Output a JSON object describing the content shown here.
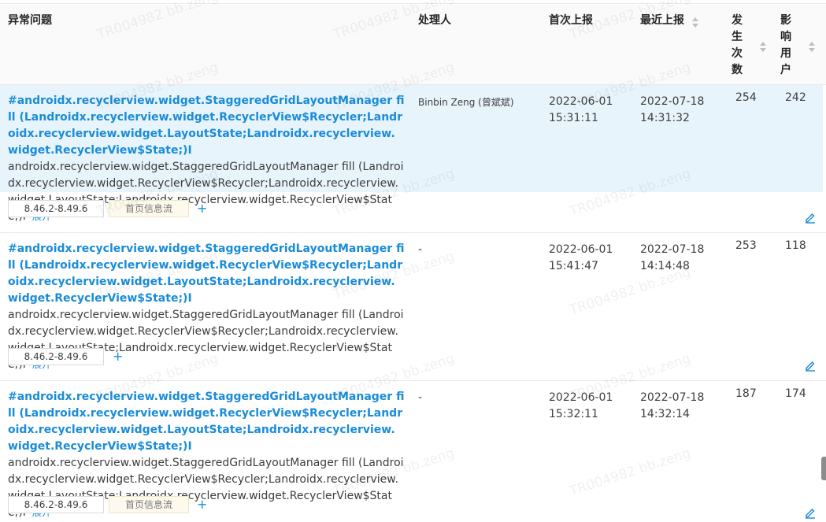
{
  "colors": {
    "link": "#1a8cd8",
    "row_highlight": "#e8f4fc",
    "header_bg": "#fafafa"
  },
  "watermark_text": "TR004982 bb.zeng",
  "columns": {
    "issue": "异常问题",
    "handler": "处理人",
    "first_report": "首次上报",
    "last_report": "最近上报",
    "occurrences": [
      "发",
      "生",
      "次",
      "数"
    ],
    "affected_users": [
      "影",
      "响",
      "用",
      "户"
    ]
  },
  "expand_label": "展开",
  "plus_label": "+",
  "rows": [
    {
      "title": "#androidx.recyclerview.widget.StaggeredGridLayoutManager fill (Landroidx.recyclerview.widget.RecyclerView$Recycler;Landroidx.recyclerview.widget.LayoutState;Landroidx.recyclerview.widget.RecyclerView$State;)I",
      "desc": "androidx.recyclerview.widget.StaggeredGridLayoutManager fill (Landroidx.recyclerview.widget.RecyclerView$Recycler;Landroidx.recyclerview.widget.LayoutState;Landroidx.recyclerview.widget.RecyclerView$State;)I",
      "handler": "Binbin Zeng (曾斌斌)",
      "first_date": "2022-06-01",
      "first_time": "15:31:11",
      "last_date": "2022-07-18",
      "last_time": "14:31:32",
      "count": "254",
      "users": "242",
      "version": "8.46.2-8.49.6",
      "page": "首页信息流"
    },
    {
      "title": "#androidx.recyclerview.widget.StaggeredGridLayoutManager fill (Landroidx.recyclerview.widget.RecyclerView$Recycler;Landroidx.recyclerview.widget.LayoutState;Landroidx.recyclerview.widget.RecyclerView$State;)I",
      "desc": "androidx.recyclerview.widget.StaggeredGridLayoutManager fill (Landroidx.recyclerview.widget.RecyclerView$Recycler;Landroidx.recyclerview.widget.LayoutState;Landroidx.recyclerview.widget.RecyclerView$State;)I",
      "handler": "-",
      "first_date": "2022-06-01",
      "first_time": "15:41:47",
      "last_date": "2022-07-18",
      "last_time": "14:14:48",
      "count": "253",
      "users": "118",
      "version": "8.46.2-8.49.6",
      "page": ""
    },
    {
      "title": "#androidx.recyclerview.widget.StaggeredGridLayoutManager fill (Landroidx.recyclerview.widget.RecyclerView$Recycler;Landroidx.recyclerview.widget.LayoutState;Landroidx.recyclerview.widget.RecyclerView$State;)I",
      "desc": "androidx.recyclerview.widget.StaggeredGridLayoutManager fill (Landroidx.recyclerview.widget.RecyclerView$Recycler;Landroidx.recyclerview.widget.LayoutState;Landroidx.recyclerview.widget.RecyclerView$State;)I",
      "handler": "-",
      "first_date": "2022-06-01",
      "first_time": "15:32:11",
      "last_date": "2022-07-18",
      "last_time": "14:32:14",
      "count": "187",
      "users": "174",
      "version": "8.46.2-8.49.6",
      "page": "首页信息流"
    }
  ]
}
